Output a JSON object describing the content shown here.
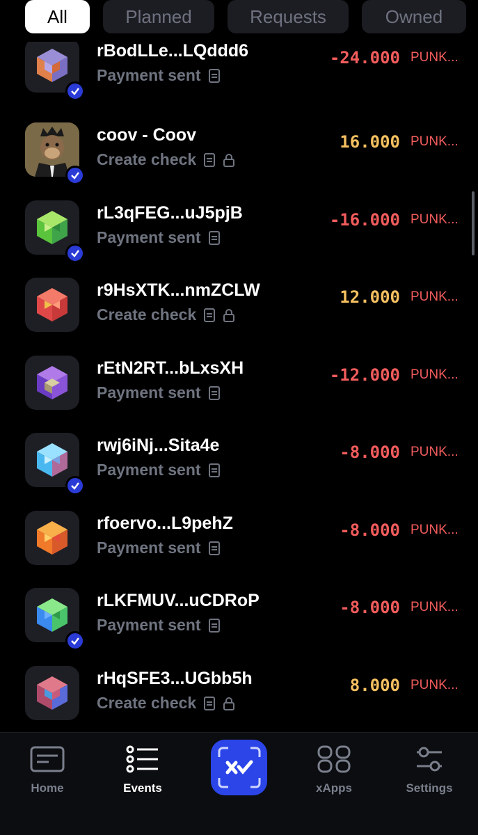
{
  "tabs": [
    {
      "label": "All",
      "active": true
    },
    {
      "label": "Planned",
      "active": false
    },
    {
      "label": "Requests",
      "active": false
    },
    {
      "label": "Owned",
      "active": false
    }
  ],
  "events": [
    {
      "title": "rBodLLe...LQddd6",
      "subtitle": "Payment sent",
      "amount": "-24.000",
      "currency": "PUNK...",
      "verified": true,
      "locked": false
    },
    {
      "title": "coov - Coov",
      "subtitle": "Create check",
      "amount": "16.000",
      "currency": "PUNK...",
      "verified": true,
      "locked": true
    },
    {
      "title": "rL3qFEG...uJ5pjB",
      "subtitle": "Payment sent",
      "amount": "-16.000",
      "currency": "PUNK...",
      "verified": true,
      "locked": false
    },
    {
      "title": "r9HsXTK...nmZCLW",
      "subtitle": "Create check",
      "amount": "12.000",
      "currency": "PUNK...",
      "verified": false,
      "locked": true
    },
    {
      "title": "rEtN2RT...bLxsXH",
      "subtitle": "Payment sent",
      "amount": "-12.000",
      "currency": "PUNK...",
      "verified": false,
      "locked": false
    },
    {
      "title": "rwj6iNj...Sita4e",
      "subtitle": "Payment sent",
      "amount": "-8.000",
      "currency": "PUNK...",
      "verified": true,
      "locked": false
    },
    {
      "title": "rfoervo...L9pehZ",
      "subtitle": "Payment sent",
      "amount": "-8.000",
      "currency": "PUNK...",
      "verified": false,
      "locked": false
    },
    {
      "title": "rLKFMUV...uCDRoP",
      "subtitle": "Payment sent",
      "amount": "-8.000",
      "currency": "PUNK...",
      "verified": true,
      "locked": false
    },
    {
      "title": "rHqSFE3...UGbb5h",
      "subtitle": "Create check",
      "amount": "8.000",
      "currency": "PUNK...",
      "verified": false,
      "locked": true
    }
  ],
  "nav": {
    "home": "Home",
    "events": "Events",
    "xapps": "xApps",
    "settings": "Settings"
  },
  "colors": {
    "negative": "#f25c5c",
    "positive": "#f5c060",
    "accent": "#2b45e8"
  }
}
